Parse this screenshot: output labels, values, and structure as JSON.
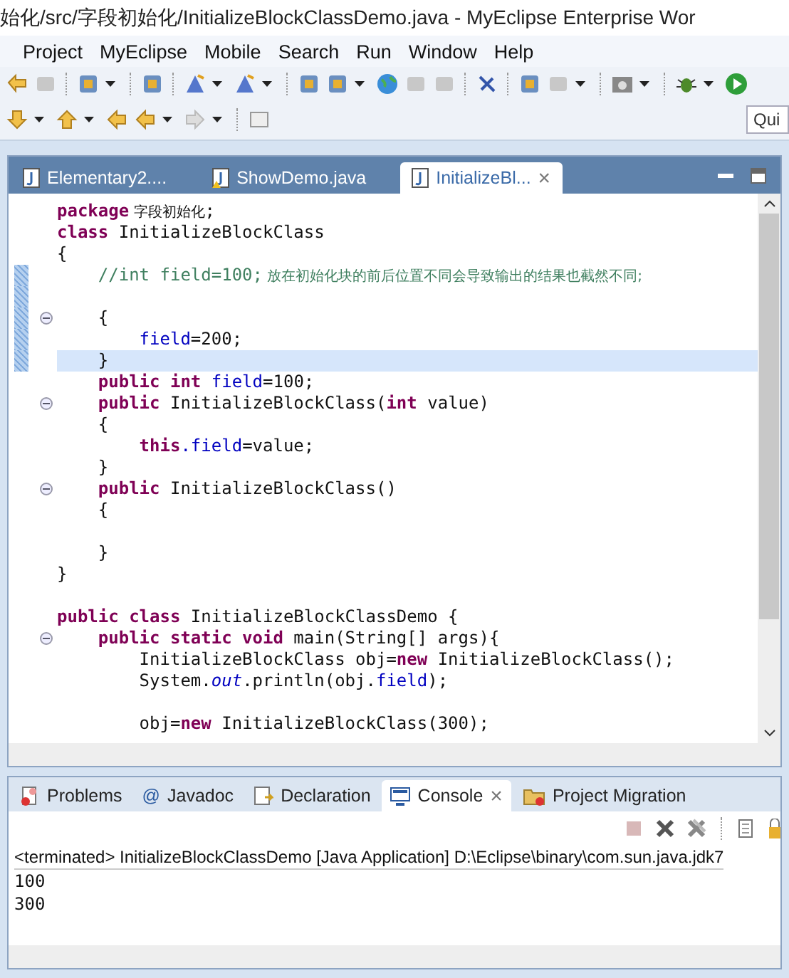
{
  "window": {
    "title": "始化/src/字段初始化/InitializeBlockClassDemo.java - MyEclipse Enterprise Wor"
  },
  "menu": [
    "Project",
    "MyEclipse",
    "Mobile",
    "Search",
    "Run",
    "Window",
    "Help"
  ],
  "quick_access": {
    "placeholder": "Qui"
  },
  "editor_tabs": [
    {
      "label": "Elementary2....",
      "selected": false,
      "warning": false
    },
    {
      "label": "ShowDemo.java",
      "selected": false,
      "warning": true
    },
    {
      "label": "InitializeBl...",
      "selected": true,
      "warning": false
    }
  ],
  "close_glyph": "×",
  "code_lines": [
    {
      "fold": false,
      "current": false,
      "changed": false,
      "tokens": [
        {
          "kind": "kw",
          "text": "package"
        },
        {
          "kind": "cjk",
          "text": " 字段初始化"
        },
        {
          "kind": "plain",
          "text": ";"
        }
      ]
    },
    {
      "fold": false,
      "current": false,
      "changed": false,
      "tokens": [
        {
          "kind": "kw",
          "text": "class"
        },
        {
          "kind": "plain",
          "text": " InitializeBlockClass"
        }
      ]
    },
    {
      "fold": false,
      "current": false,
      "changed": false,
      "tokens": [
        {
          "kind": "plain",
          "text": "{"
        }
      ]
    },
    {
      "fold": false,
      "current": false,
      "changed": true,
      "tokens": [
        {
          "kind": "comment",
          "text": "    //int field=100;"
        },
        {
          "kind": "cjkcomment",
          "text": " 放在初始化块的前后位置不同会导致输出的结果也截然不同;"
        }
      ]
    },
    {
      "fold": false,
      "current": false,
      "changed": true
    },
    {
      "fold": true,
      "current": false,
      "changed": true,
      "tokens": [
        {
          "kind": "plain",
          "text": "    {"
        }
      ]
    },
    {
      "fold": false,
      "current": false,
      "changed": true,
      "tokens": [
        {
          "kind": "field",
          "text": "        field"
        },
        {
          "kind": "plain",
          "text": "=200;"
        }
      ]
    },
    {
      "fold": false,
      "current": true,
      "changed": true,
      "tokens": [
        {
          "kind": "plain",
          "text": "    }"
        }
      ]
    },
    {
      "fold": false,
      "current": false,
      "changed": false,
      "tokens": [
        {
          "kind": "kw",
          "text": "    public int"
        },
        {
          "kind": "field",
          "text": " field"
        },
        {
          "kind": "plain",
          "text": "=100;"
        }
      ]
    },
    {
      "fold": true,
      "current": false,
      "changed": false,
      "tokens": [
        {
          "kind": "kw",
          "text": "    public"
        },
        {
          "kind": "plain",
          "text": " InitializeBlockClass("
        },
        {
          "kind": "kw",
          "text": "int"
        },
        {
          "kind": "plain",
          "text": " value)"
        }
      ]
    },
    {
      "fold": false,
      "current": false,
      "changed": false,
      "tokens": [
        {
          "kind": "plain",
          "text": "    {"
        }
      ]
    },
    {
      "fold": false,
      "current": false,
      "changed": false,
      "tokens": [
        {
          "kind": "kw",
          "text": "        this"
        },
        {
          "kind": "field",
          "text": ".field"
        },
        {
          "kind": "plain",
          "text": "=value;"
        }
      ]
    },
    {
      "fold": false,
      "current": false,
      "changed": false,
      "tokens": [
        {
          "kind": "plain",
          "text": "    }"
        }
      ]
    },
    {
      "fold": true,
      "current": false,
      "changed": false,
      "tokens": [
        {
          "kind": "kw",
          "text": "    public"
        },
        {
          "kind": "plain",
          "text": " InitializeBlockClass()"
        }
      ]
    },
    {
      "fold": false,
      "current": false,
      "changed": false,
      "tokens": [
        {
          "kind": "plain",
          "text": "    {"
        }
      ]
    },
    {
      "fold": false,
      "current": false,
      "changed": false
    },
    {
      "fold": false,
      "current": false,
      "changed": false,
      "tokens": [
        {
          "kind": "plain",
          "text": "    }"
        }
      ]
    },
    {
      "fold": false,
      "current": false,
      "changed": false,
      "tokens": [
        {
          "kind": "plain",
          "text": "}"
        }
      ]
    },
    {
      "fold": false,
      "current": false,
      "changed": false
    },
    {
      "fold": false,
      "current": false,
      "changed": false,
      "tokens": [
        {
          "kind": "kw",
          "text": "public class"
        },
        {
          "kind": "plain",
          "text": " InitializeBlockClassDemo {"
        }
      ]
    },
    {
      "fold": true,
      "current": false,
      "changed": false,
      "tokens": [
        {
          "kind": "kw",
          "text": "    public static void"
        },
        {
          "kind": "plain",
          "text": " main(String[] args){"
        }
      ]
    },
    {
      "fold": false,
      "current": false,
      "changed": false,
      "tokens": [
        {
          "kind": "plain",
          "text": "        InitializeBlockClass obj="
        },
        {
          "kind": "kw",
          "text": "new"
        },
        {
          "kind": "plain",
          "text": " InitializeBlockClass();"
        }
      ]
    },
    {
      "fold": false,
      "current": false,
      "changed": false,
      "tokens": [
        {
          "kind": "plain",
          "text": "        System."
        },
        {
          "kind": "static",
          "text": "out"
        },
        {
          "kind": "plain",
          "text": ".println(obj."
        },
        {
          "kind": "field",
          "text": "field"
        },
        {
          "kind": "plain",
          "text": ");"
        }
      ]
    },
    {
      "fold": false,
      "current": false,
      "changed": false
    },
    {
      "fold": false,
      "current": false,
      "changed": false,
      "tokens": [
        {
          "kind": "plain",
          "text": "        obj="
        },
        {
          "kind": "kw",
          "text": "new"
        },
        {
          "kind": "plain",
          "text": " InitializeBlockClass(300);"
        }
      ]
    }
  ],
  "bottom_tabs": [
    {
      "label": "Problems",
      "selected": false
    },
    {
      "label": "Javadoc",
      "selected": false
    },
    {
      "label": "Declaration",
      "selected": false
    },
    {
      "label": "Console",
      "selected": true
    },
    {
      "label": "Project Migration",
      "selected": false
    }
  ],
  "at_glyph": "@",
  "console": {
    "header": "<terminated> InitializeBlockClassDemo [Java Application] D:\\Eclipse\\binary\\com.sun.java.jdk7",
    "output": [
      "100",
      "300"
    ]
  }
}
